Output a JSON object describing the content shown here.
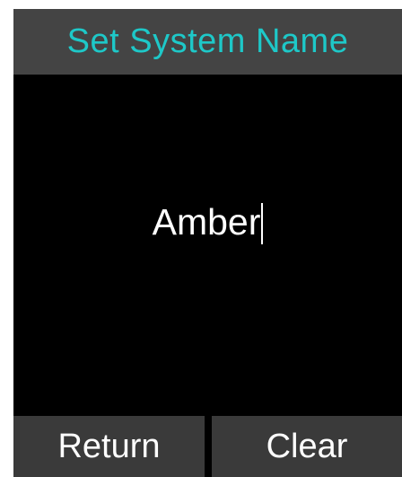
{
  "screen": {
    "title": "Set System Name",
    "name_input": {
      "value": "Amber",
      "cursor_visible": true
    },
    "softkeys": {
      "left_label": "Return",
      "right_label": "Clear"
    },
    "colors": {
      "title_text": "#1ec8c8",
      "title_background": "#444444",
      "background": "#000000",
      "softkey_background": "#3a3a3a",
      "text": "#ffffff"
    }
  }
}
